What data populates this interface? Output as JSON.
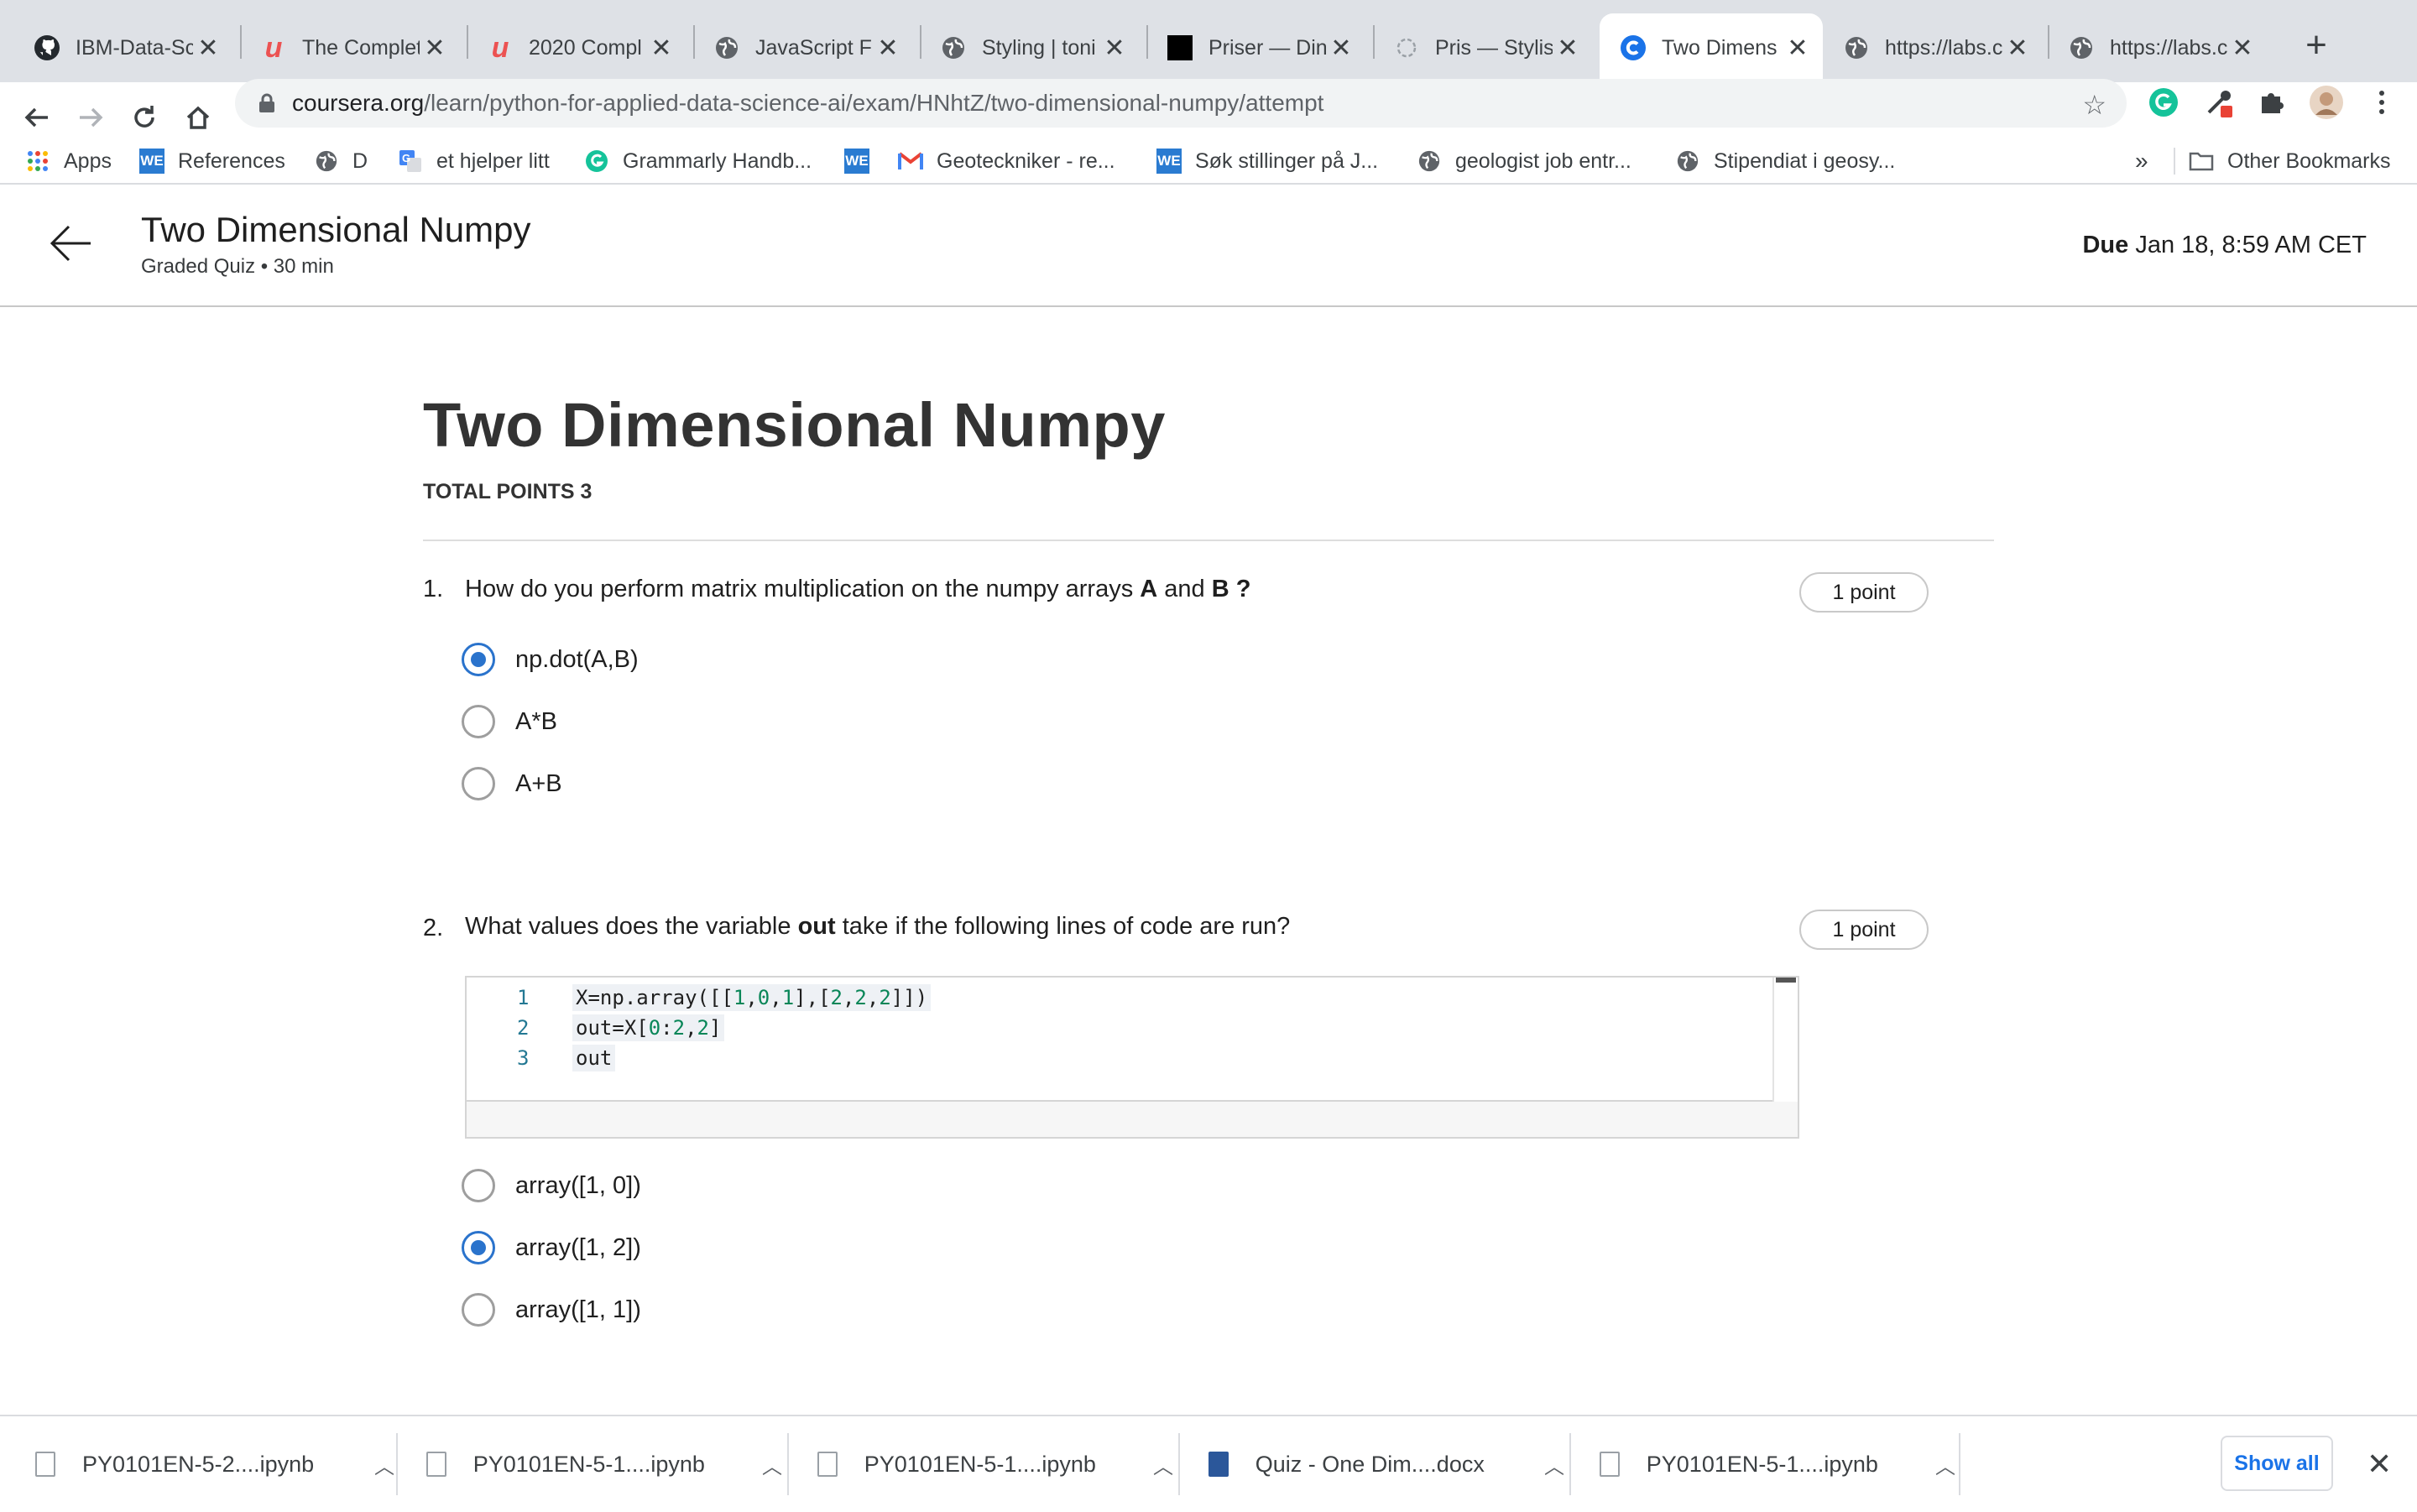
{
  "browser": {
    "tabs": [
      {
        "title": "IBM-Data-Sc",
        "icon": "github-icon",
        "active": false
      },
      {
        "title": "The Complet",
        "icon": "udemy-icon",
        "active": false
      },
      {
        "title": "2020 Compl",
        "icon": "udemy-icon",
        "active": false
      },
      {
        "title": "JavaScript F",
        "icon": "globe-icon",
        "active": false
      },
      {
        "title": "Styling | toni",
        "icon": "globe-icon",
        "active": false
      },
      {
        "title": "Priser — Din",
        "icon": "mood-icon",
        "active": false
      },
      {
        "title": "Pris — Stylis",
        "icon": "loading-icon",
        "active": false
      },
      {
        "title": "Two Dimens",
        "icon": "coursera-icon",
        "active": true
      },
      {
        "title": "https://labs.c",
        "icon": "globe-icon",
        "active": false
      },
      {
        "title": "https://labs.c",
        "icon": "globe-icon",
        "active": false
      }
    ],
    "url_host": "coursera.org",
    "url_path": "/learn/python-for-applied-data-science-ai/exam/HNhtZ/two-dimensional-numpy/attempt",
    "bookmarks": [
      {
        "label": "Apps",
        "icon": "apps-grid-icon"
      },
      {
        "label": "References",
        "icon": "we-icon"
      },
      {
        "label": "D",
        "icon": "globe-icon"
      },
      {
        "label": "et hjelper litt",
        "icon": "translate-icon"
      },
      {
        "label": "Grammarly Handb...",
        "icon": "grammarly-icon"
      },
      {
        "label": "",
        "icon": "we-icon"
      },
      {
        "label": "Geoteckniker - re...",
        "icon": "gmail-icon"
      },
      {
        "label": "Søk stillinger på J...",
        "icon": "we-icon"
      },
      {
        "label": "geologist job entr...",
        "icon": "globe-icon"
      },
      {
        "label": "Stipendiat i geosy...",
        "icon": "globe-icon"
      }
    ],
    "bookmarks_overflow": "»",
    "other_bookmarks": "Other Bookmarks",
    "accent_color": "#1a73e8"
  },
  "header": {
    "title": "Two Dimensional Numpy",
    "subtitle": "Graded Quiz • 30 min",
    "due_label": "Due",
    "due_value": "Jan 18, 8:59 AM CET"
  },
  "quiz": {
    "title": "Two Dimensional Numpy",
    "total_points": "TOTAL POINTS 3",
    "questions": [
      {
        "number": "1.",
        "text_parts": [
          "How do you perform matrix multiplication on the numpy arrays ",
          "A",
          " and ",
          "B ?"
        ],
        "points": "1 point",
        "options": [
          {
            "label": "np.dot(A,B)",
            "selected": true
          },
          {
            "label": "A*B",
            "selected": false
          },
          {
            "label": "A+B",
            "selected": false
          }
        ]
      },
      {
        "number": "2.",
        "text_parts": [
          "What values does the variable ",
          "out",
          " take if the following lines of code are run?"
        ],
        "points": "1 point",
        "code_lines": [
          {
            "n": "1",
            "code": "X=np.array([[1,0,1],[2,2,2]])"
          },
          {
            "n": "2",
            "code": "out=X[0:2,2]"
          },
          {
            "n": "3",
            "code": "out"
          }
        ],
        "options": [
          {
            "label": "array([1, 0])",
            "selected": false
          },
          {
            "label": "array([1, 2])",
            "selected": true
          },
          {
            "label": "array([1, 1])",
            "selected": false
          }
        ]
      }
    ],
    "radio_color": "#2a73cc"
  },
  "downloads": {
    "items": [
      {
        "name": "PY0101EN-5-2....ipynb",
        "icon": "file-icon"
      },
      {
        "name": "PY0101EN-5-1....ipynb",
        "icon": "file-icon"
      },
      {
        "name": "PY0101EN-5-1....ipynb",
        "icon": "file-icon"
      },
      {
        "name": "Quiz - One Dim....docx",
        "icon": "word-doc-icon"
      },
      {
        "name": "PY0101EN-5-1....ipynb",
        "icon": "file-icon"
      }
    ],
    "show_all": "Show all"
  }
}
